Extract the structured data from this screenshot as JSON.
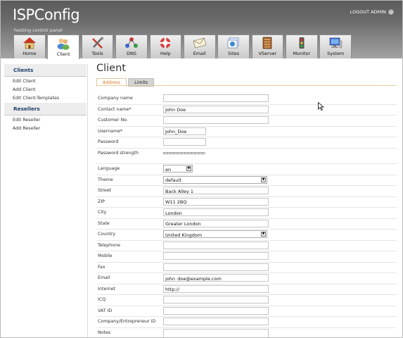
{
  "header": {
    "logo": "ISPConfig",
    "tagline": "hosting control panel",
    "logout_label": "LOGOUT ADMIN"
  },
  "tabs": [
    {
      "label": "Home",
      "icon": "home-icon"
    },
    {
      "label": "Client",
      "icon": "client-icon"
    },
    {
      "label": "Tools",
      "icon": "tools-icon"
    },
    {
      "label": "DNS",
      "icon": "dns-icon"
    },
    {
      "label": "Help",
      "icon": "help-icon"
    },
    {
      "label": "Email",
      "icon": "email-icon"
    },
    {
      "label": "Sites",
      "icon": "sites-icon"
    },
    {
      "label": "VServer",
      "icon": "vserver-icon"
    },
    {
      "label": "Monitor",
      "icon": "monitor-icon"
    },
    {
      "label": "System",
      "icon": "system-icon"
    }
  ],
  "active_tab": "Client",
  "sidebar": {
    "clients_heading": "Clients",
    "clients_items": [
      "Edit Client",
      "Add Client",
      "Edit Client-Templates"
    ],
    "resellers_heading": "Resellers",
    "resellers_items": [
      "Edit Reseller",
      "Add Reseller"
    ]
  },
  "page": {
    "title": "Client",
    "form_tabs": [
      "Address",
      "Limits"
    ],
    "active_form_tab": "Address"
  },
  "form": {
    "company_name": {
      "label": "Company name",
      "value": ""
    },
    "contact_name": {
      "label": "Contact name*",
      "value": "John Doe"
    },
    "customer_no": {
      "label": "Customer No.",
      "value": ""
    },
    "username": {
      "label": "Username*",
      "value": "John_Doe"
    },
    "password": {
      "label": "Password",
      "value": ""
    },
    "password_strength": {
      "label": "Password strength"
    },
    "language": {
      "label": "Language",
      "value": "en"
    },
    "theme": {
      "label": "Theme",
      "value": "default"
    },
    "street": {
      "label": "Street",
      "value": "Back Alley 1"
    },
    "zip": {
      "label": "ZIP",
      "value": "W11 2BQ"
    },
    "city": {
      "label": "City",
      "value": "London"
    },
    "state": {
      "label": "State",
      "value": "Greater London"
    },
    "country": {
      "label": "Country",
      "value": "United Kingdom"
    },
    "telephone": {
      "label": "Telephone",
      "value": ""
    },
    "mobile": {
      "label": "Mobile",
      "value": ""
    },
    "fax": {
      "label": "Fax",
      "value": ""
    },
    "email": {
      "label": "Email",
      "value": "john_doe@example.com"
    },
    "internet": {
      "label": "Internet",
      "value": "http://"
    },
    "icq": {
      "label": "ICQ",
      "value": ""
    },
    "vat_id": {
      "label": "VAT ID",
      "value": ""
    },
    "company_id": {
      "label": "Company/Entrepreneur ID",
      "value": ""
    },
    "notes": {
      "label": "Notes",
      "value": ""
    }
  },
  "colors": {
    "header_dark": "#5b5b5b",
    "sidebar_heading": "#1d3c66",
    "active_form_tab": "#d9781f"
  }
}
